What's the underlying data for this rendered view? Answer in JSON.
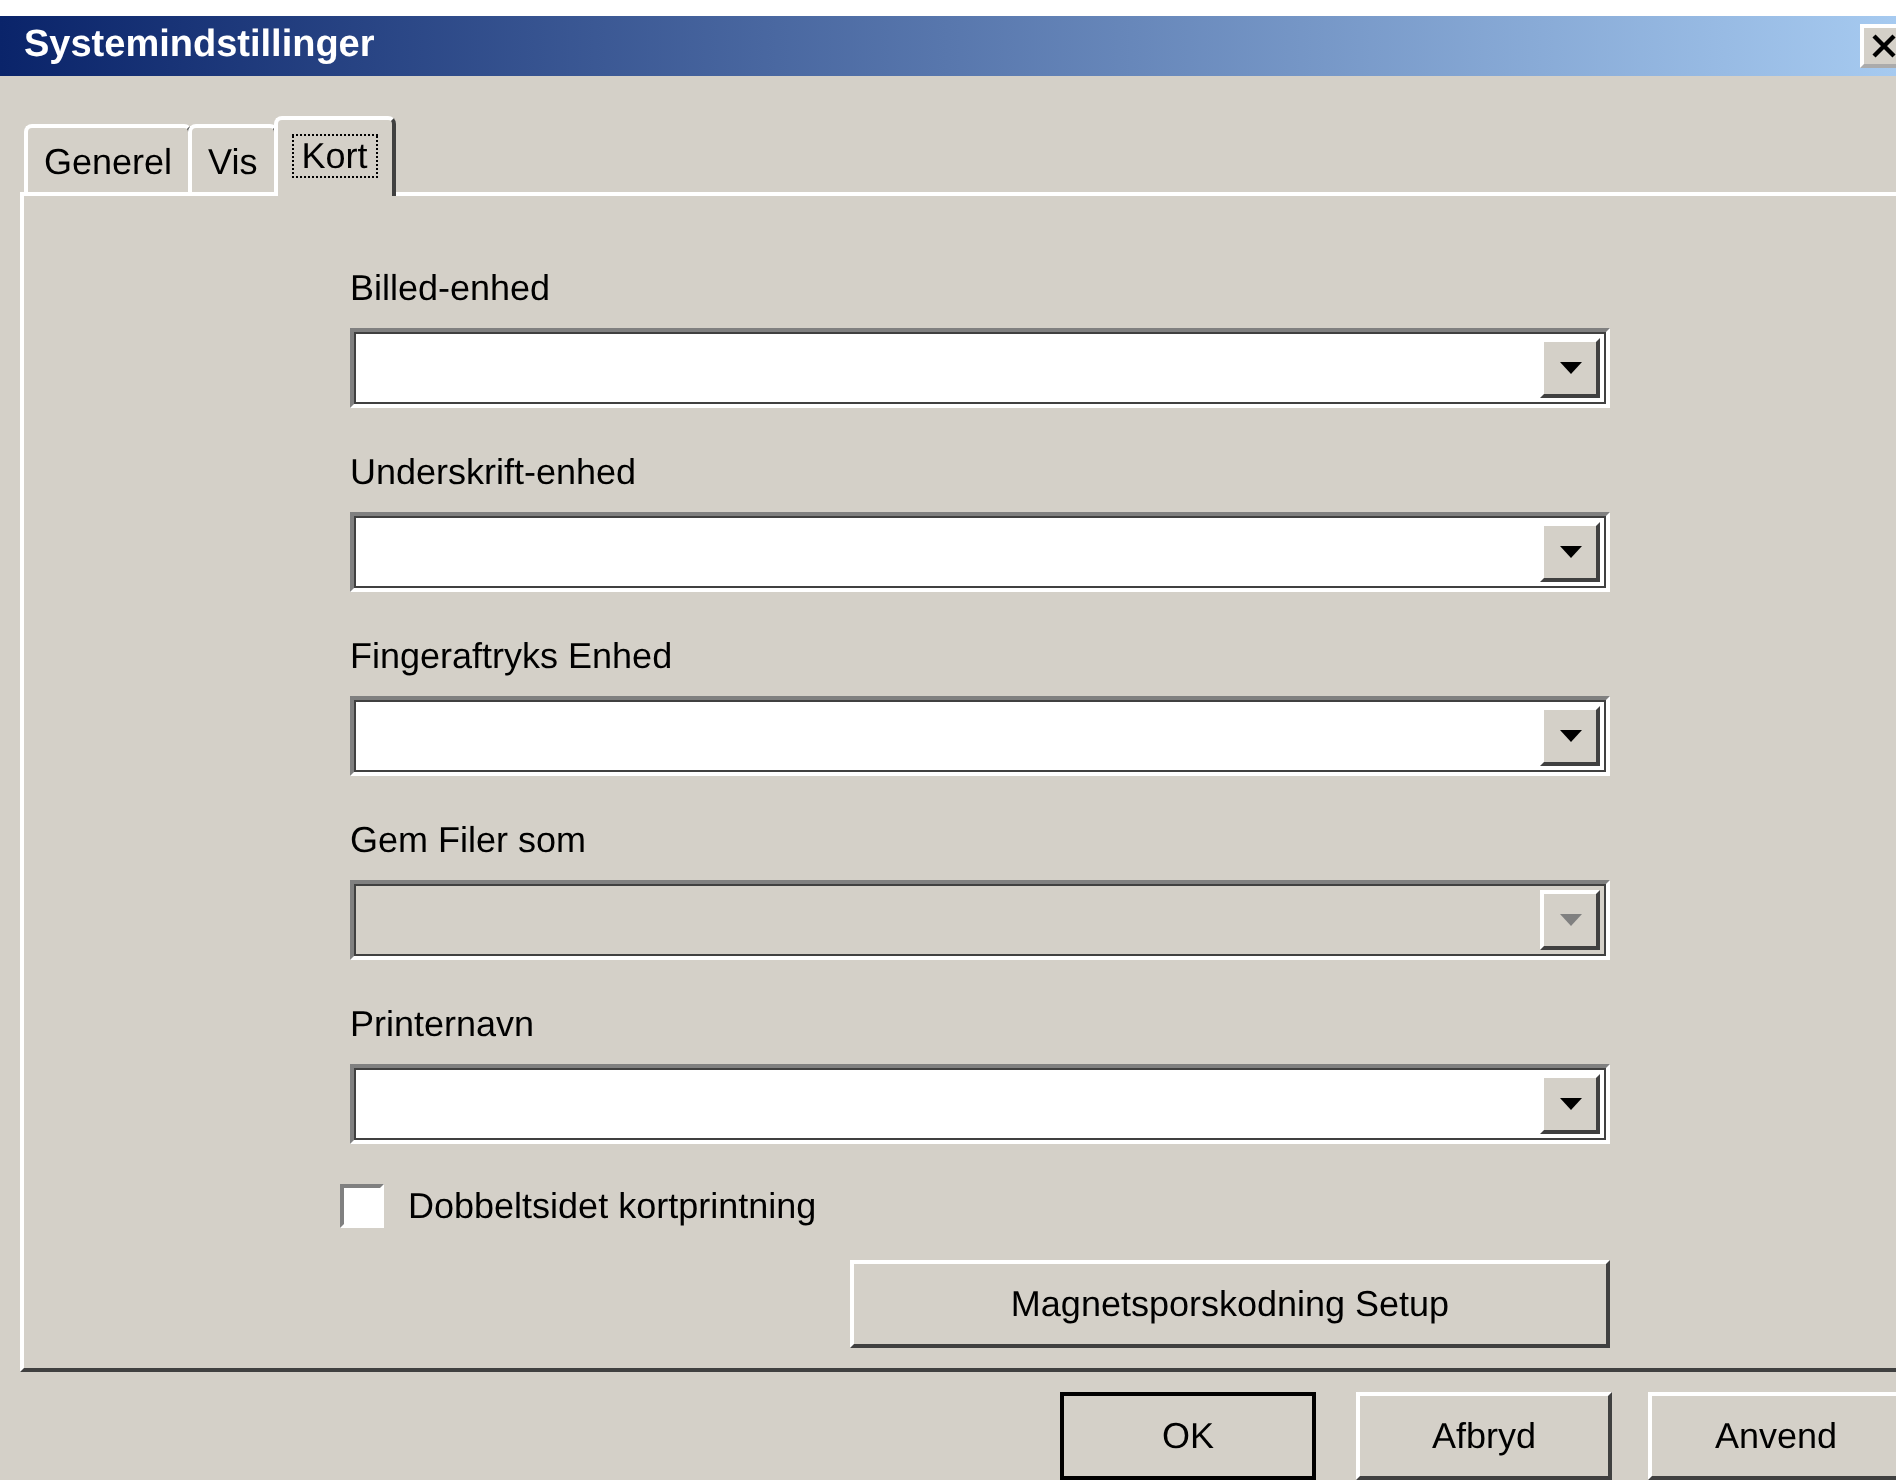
{
  "window": {
    "title": "Systemindstillinger"
  },
  "tabs": [
    {
      "label": "Generel",
      "selected": false
    },
    {
      "label": "Vis",
      "selected": false
    },
    {
      "label": "Kort",
      "selected": true
    }
  ],
  "fields": [
    {
      "label": "Billed-enhed",
      "disabled": false
    },
    {
      "label": "Underskrift-enhed",
      "disabled": false
    },
    {
      "label": "Fingeraftryks Enhed",
      "disabled": false
    },
    {
      "label": "Gem Filer som",
      "disabled": true
    },
    {
      "label": "Printernavn",
      "disabled": false
    }
  ],
  "checkbox": {
    "label": "Dobbeltsidet kortprintning",
    "checked": false
  },
  "setup_button": "Magnetsporskodning Setup",
  "buttons": [
    {
      "label": "OK",
      "default": true
    },
    {
      "label": "Afbryd",
      "default": false
    },
    {
      "label": "Anvend",
      "default": false
    }
  ]
}
